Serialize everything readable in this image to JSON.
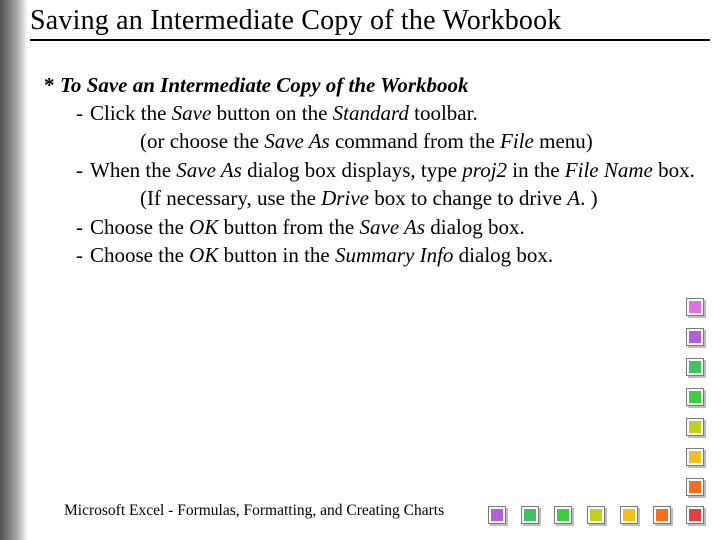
{
  "title": "Saving an Intermediate Copy of the Workbook",
  "heading": "To Save an Intermediate Copy of the Workbook",
  "line1a": "Click the ",
  "line1_save": "Save",
  "line1b": " button on the ",
  "line1_standard": "Standard",
  "line1c": " toolbar.",
  "line2a": "(or choose the ",
  "line2_saveas": "Save  As",
  "line2b": " command from the ",
  "line2_file": "File",
  "line2c": " menu)",
  "line3a": "When the ",
  "line3_saveas": "Save As",
  "line3b": " dialog box displays, type ",
  "line3_proj2": "proj2",
  "line3c": " in the ",
  "line3_filename": "File Name",
  "line3d": " box.",
  "line4a": "(If necessary, use the ",
  "line4_drive": "Drive",
  "line4b": " box to change to drive ",
  "line4_a": "A",
  "line4c": ". )",
  "line5a": "Choose the ",
  "line5_ok": "OK",
  "line5b": " button from the ",
  "line5_saveas": "Save As",
  "line5c": " dialog box.",
  "line6a": "Choose the ",
  "line6_ok": "OK",
  "line6b": " button in the ",
  "line6_summary": "Summary Info",
  "line6c": " dialog box.",
  "footer": "Microsoft  Excel - Formulas, Formatting, and Creating Charts"
}
